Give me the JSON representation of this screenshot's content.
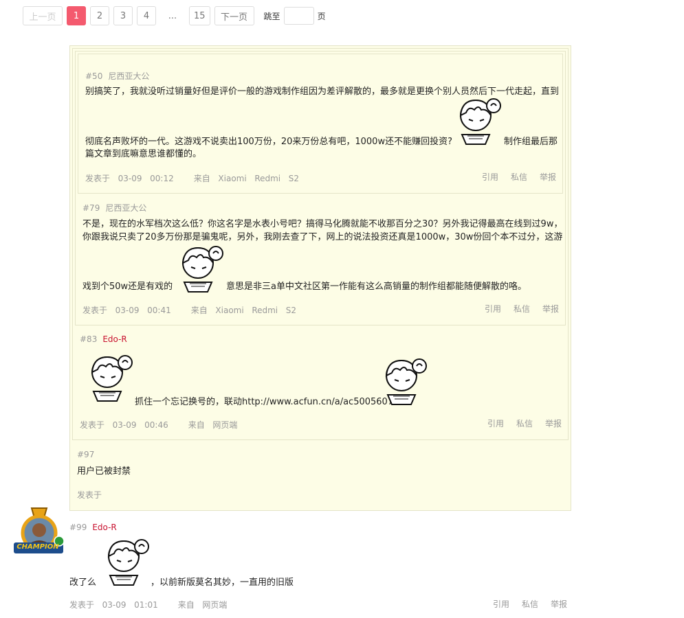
{
  "pagination": {
    "prev": "上一页",
    "pages": [
      "1",
      "2",
      "3",
      "4"
    ],
    "ellipsis": "...",
    "last": "15",
    "next": "下一页",
    "jump_label": "跳至",
    "jump_suffix": "页",
    "current": "1"
  },
  "comments": [
    {
      "floor": "#50",
      "user": "尼西亚大公",
      "text_parts": [
        "别搞笑了，我就没听过销量好但是评价一般的游戏制作组因为差评解散的，最多就是更换个别人员然后下一代走起，直到",
        "彻底名声败坏的一代。这游戏不说卖出100万份，20来万份总有吧，1000w还不能赚回投资?",
        "制作组最后那",
        "篇文章到底嘛意思谁都懂的。"
      ],
      "footer": "发表于  03-09  00:12     来自  Xiaomi  Redmi  S2"
    },
    {
      "floor": "#79",
      "user": "尼西亚大公",
      "text_parts": [
        "不是，现在的水军档次这么低？你这名字是水表小号吧？搞得马化腾就能不收那百分之30？另外我记得最高在线到过9w，",
        "你跟我说只卖了20多万份那是骗鬼呢，另外，我刚去查了下，网上的说法投资还真是1000w，30w份回个本不过分，这游",
        "戏到个50w还是有戏的",
        "意思是非三a单中文社区第一作能有这么高销量的制作组都能随便解散的咯。"
      ],
      "footer": "发表于  03-09  00:41     来自  Xiaomi  Redmi  S2"
    },
    {
      "floor": "#83",
      "user": "Edo-R",
      "text_parts": [
        "抓住一个忘记换号的，联动http://www.acfun.cn/a/ac5005607"
      ],
      "footer": "发表于  03-09  00:46     来自  网页端"
    },
    {
      "floor": "#97",
      "user": "",
      "text_parts": [
        "用户已被封禁"
      ],
      "footer": "发表于"
    },
    {
      "floor": "#99",
      "user": "Edo-R",
      "text_parts": [
        "改了么",
        "，以前新版莫名其妙，一直用的旧版"
      ],
      "footer": "发表于  03-09  01:01     来自  网页端"
    }
  ],
  "actions": {
    "quote": "引用",
    "message": "私信",
    "report": "举报"
  },
  "avatar_badge": "CHAMPION",
  "colors": {
    "accent": "#f45a6e",
    "username_red": "#c8102e",
    "quote_bg": "#fdfde6"
  }
}
